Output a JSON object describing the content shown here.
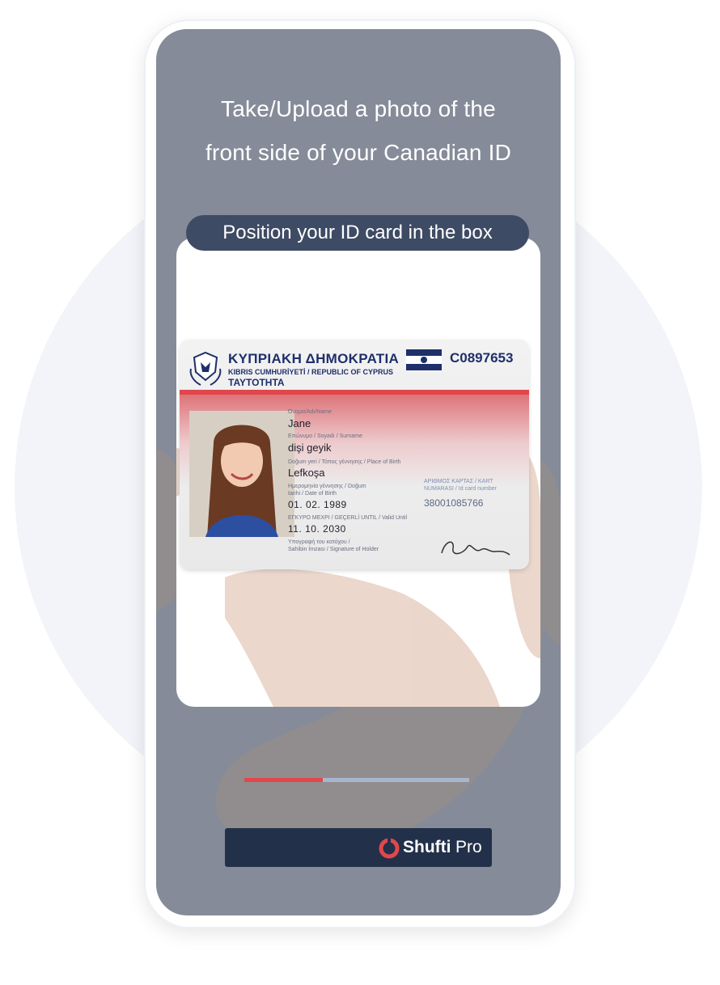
{
  "header": {
    "line1": "Take/Upload a photo of the",
    "line2": "front side of your Canadian ID"
  },
  "hint": "Position your ID card in the box",
  "id_card": {
    "title": "ΚΥΠΡΙΑΚΗ ΔΗΜΟΚΡΑΤΙΑ",
    "subtitle": "KIBRIS CUMHURİYETİ / REPUBLIC OF CYPRUS",
    "doc_type": "ΤΑΥΤΟΤΗΤΑ",
    "card_number": "C0897653",
    "name_label": "Όνομα/Adı/Name",
    "name_value": "Jane",
    "surname_label": "Επώνυμο / Soyadı / Surname",
    "surname_value": "dişi geyik",
    "pob_label": "Doğum yeri / Τόπος γέννησης / Place of Birth",
    "pob_value": "Lefkoşa",
    "dob_label_1": "Ημερομηνία γέννησης / Doğum",
    "dob_label_2": "tarihi / Date of Birth",
    "dob_value": "01. 02. 1989",
    "valid_label": "ΕΓΚΥΡΟ ΜΕΧΡΙ / GEÇERLİ UNTIL / Valid Until",
    "valid_value": "11. 10. 2030",
    "idnum_label_1": "ΑΡΙΘΜΟΣ ΚΑΡΤΑΣ / KART",
    "idnum_label_2": "NUMARASI / Id card number",
    "idnum_value": "38001085766",
    "sig_label_1": "Υπογραφή του κατόχου /",
    "sig_label_2": "Sahibin İmzası / Signature of Holder"
  },
  "progress": {
    "fraction": 0.35
  },
  "brand": {
    "name": "Shufti",
    "suffix": "Pro",
    "icon": "shufti-ring-icon"
  },
  "colors": {
    "accent": "#e2474c",
    "panel": "#233049",
    "screen": "#858b98"
  }
}
